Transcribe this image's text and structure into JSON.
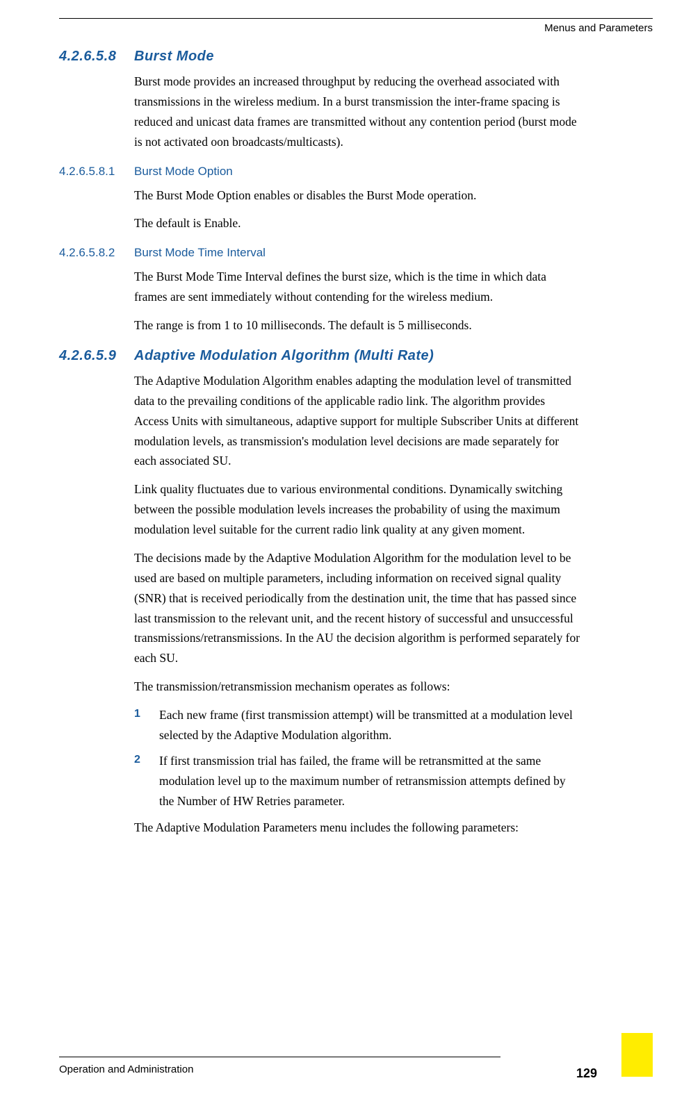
{
  "header": {
    "running": "Menus and Parameters"
  },
  "sections": [
    {
      "num": "4.2.6.5.8",
      "title": "Burst Mode",
      "level": "h3",
      "paras": [
        "Burst mode provides an increased throughput by reducing the overhead associated with transmissions in the wireless medium. In a burst transmission the inter-frame spacing is reduced and unicast data frames are transmitted without any contention period (burst mode is not activated oon broadcasts/multicasts)."
      ]
    },
    {
      "num": "4.2.6.5.8.1",
      "title": "Burst Mode Option",
      "level": "h4",
      "paras": [
        "The Burst Mode Option enables or disables the Burst Mode operation.",
        "The default is Enable."
      ]
    },
    {
      "num": "4.2.6.5.8.2",
      "title": "Burst Mode Time Interval",
      "level": "h4",
      "paras": [
        "The Burst Mode Time Interval defines the burst size, which is the time in which data frames are sent immediately without contending for the wireless medium.",
        "The range is from 1 to 10 milliseconds. The default is 5 milliseconds."
      ]
    },
    {
      "num": "4.2.6.5.9",
      "title": "Adaptive Modulation Algorithm (Multi Rate)",
      "level": "h3",
      "paras": [
        "The Adaptive Modulation Algorithm enables adapting the modulation level of transmitted data to the prevailing conditions of the applicable radio link. The algorithm provides Access Units with simultaneous, adaptive support for multiple Subscriber Units at different modulation levels, as transmission's modulation level decisions are made separately for each associated SU.",
        "Link quality fluctuates due to various environmental conditions. Dynamically switching between the possible modulation levels increases the probability of using the maximum modulation level suitable for the current radio link quality at any given moment.",
        "The decisions made by the Adaptive Modulation Algorithm for the modulation level to be used are based on multiple parameters, including information on received signal quality (SNR) that is received periodically from the destination unit, the time that has passed since last transmission to the relevant unit, and the recent history of successful and unsuccessful transmissions/retransmissions. In the AU the decision algorithm is performed separately for each SU.",
        "The transmission/retransmission mechanism operates as follows:"
      ],
      "list": [
        {
          "n": "1",
          "text": "Each new frame (first transmission attempt) will be transmitted at a modulation level selected by the Adaptive Modulation algorithm."
        },
        {
          "n": "2",
          "text": "If first transmission trial has failed, the frame will be retransmitted at the same modulation level up to the maximum number of retransmission attempts defined by the Number of HW Retries parameter."
        }
      ],
      "after_list": [
        "The Adaptive Modulation Parameters menu includes the following parameters:"
      ]
    }
  ],
  "footer": {
    "left": "Operation and Administration",
    "page": "129"
  }
}
